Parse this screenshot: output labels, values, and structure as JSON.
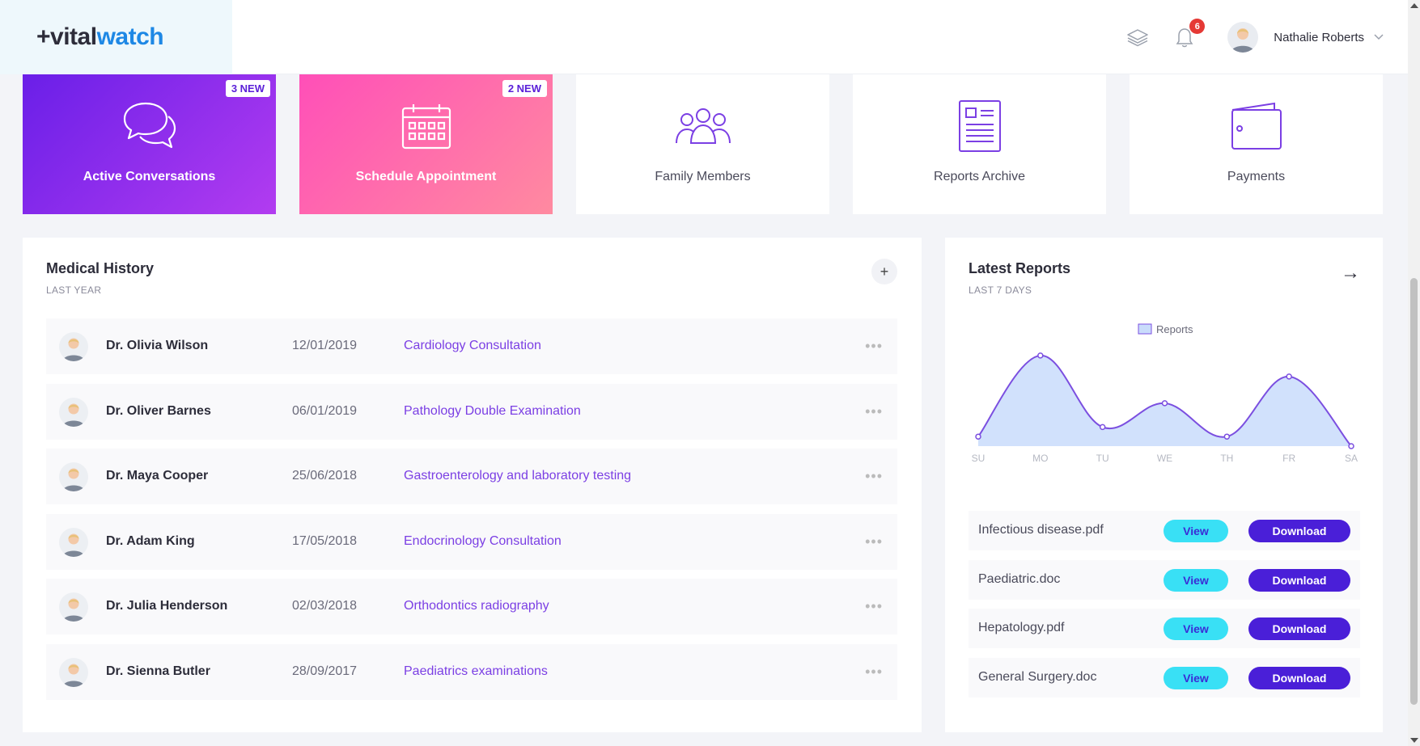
{
  "header": {
    "logo_plus": "+",
    "logo_vital": "vital",
    "logo_watch": "watch",
    "notification_count": "6",
    "user_name": "Nathalie Roberts",
    "icons": [
      "layers-icon",
      "bell-icon",
      "chevron-down-icon"
    ]
  },
  "tiles": [
    {
      "label": "Active Conversations",
      "badge": "3 NEW",
      "icon": "chat-bubbles-icon"
    },
    {
      "label": "Schedule Appointment",
      "badge": "2 NEW",
      "icon": "calendar-icon"
    },
    {
      "label": "Family Members",
      "badge": "",
      "icon": "users-group-icon"
    },
    {
      "label": "Reports Archive",
      "badge": "",
      "icon": "document-icon"
    },
    {
      "label": "Payments",
      "badge": "",
      "icon": "wallet-icon"
    }
  ],
  "medical_history": {
    "title": "Medical History",
    "subtitle": "LAST YEAR",
    "add_label": "+",
    "rows": [
      {
        "doctor": "Dr. Olivia Wilson",
        "date": "12/01/2019",
        "description": "Cardiology Consultation"
      },
      {
        "doctor": "Dr. Oliver Barnes",
        "date": "06/01/2019",
        "description": "Pathology Double Examination"
      },
      {
        "doctor": "Dr. Maya Cooper",
        "date": "25/06/2018",
        "description": "Gastroenterology and laboratory testing"
      },
      {
        "doctor": "Dr. Adam King",
        "date": "17/05/2018",
        "description": "Endocrinology Consultation"
      },
      {
        "doctor": "Dr. Julia Henderson",
        "date": "02/03/2018",
        "description": "Orthodontics radiography"
      },
      {
        "doctor": "Dr. Sienna Butler",
        "date": "28/09/2017",
        "description": "Paediatrics examinations"
      }
    ],
    "row_menu": "•••"
  },
  "latest_reports": {
    "title": "Latest Reports",
    "subtitle": "LAST 7 DAYS",
    "arrow": "→",
    "view_label": "View",
    "download_label": "Download",
    "files": [
      "Infectious disease.pdf",
      "Paediatric.doc",
      "Hepatology.pdf",
      "General Surgery.doc"
    ]
  },
  "chart_data": {
    "type": "area",
    "title": "",
    "xlabel": "",
    "ylabel": "",
    "x": [
      "SU",
      "MO",
      "TU",
      "WE",
      "TH",
      "FR",
      "SA"
    ],
    "series": [
      {
        "name": "Reports",
        "values": [
          1.0,
          9.5,
          2.0,
          4.5,
          1.0,
          7.3,
          0.0
        ]
      }
    ],
    "ylim": [
      0,
      10
    ],
    "grid": false,
    "legend": "top-center",
    "colors": {
      "line": "#7b4fe0",
      "fill": "#c9dcfb"
    }
  },
  "colors": {
    "brand_blue": "#1e88e5",
    "accent_purple": "#4a1fd8",
    "view_cyan": "#39e0f5"
  }
}
